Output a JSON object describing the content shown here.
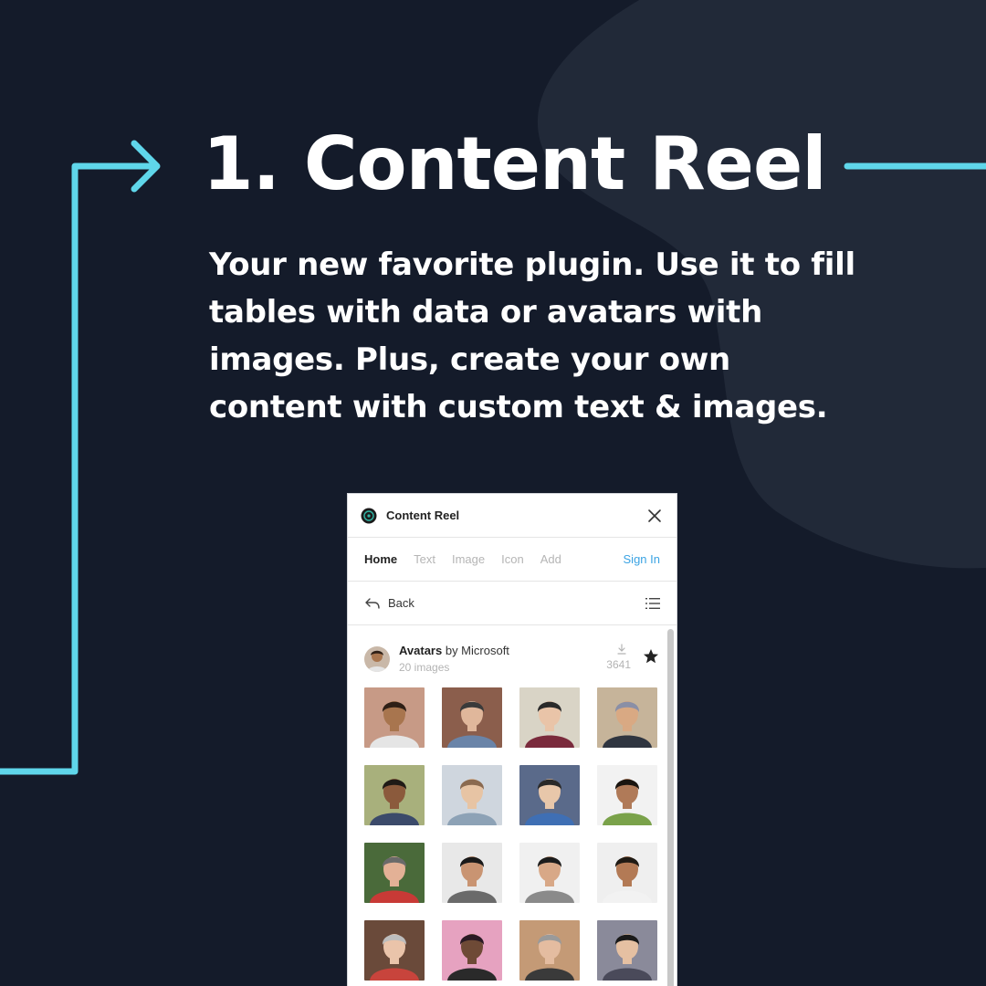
{
  "headline": "1. Content Reel",
  "description": "Your new favorite plugin. Use it to fill tables with data or avatars with images. Plus, create your own content with custom text & images.",
  "colors": {
    "background": "#141b2a",
    "blob": "#212938",
    "accent": "#5fd6ea"
  },
  "plugin": {
    "title": "Content Reel",
    "tabs": [
      "Home",
      "Text",
      "Image",
      "Icon",
      "Add"
    ],
    "active_tab": "Home",
    "sign_in": "Sign In",
    "back": "Back",
    "collection": {
      "name": "Avatars",
      "by": "by Microsoft",
      "count": "20 images",
      "downloads": "3641"
    },
    "avatars": [
      {
        "bg": "#c79a86",
        "skin": "#a8754e",
        "hair": "#2e1f16",
        "shirt": "#e5e5e5"
      },
      {
        "bg": "#8b5e4c",
        "skin": "#e0b79b",
        "hair": "#3a3a3a",
        "shirt": "#6a84a8"
      },
      {
        "bg": "#d9d4c6",
        "skin": "#e9c4a8",
        "hair": "#2a2a2a",
        "shirt": "#7a2a3c"
      },
      {
        "bg": "#c6b49a",
        "skin": "#d9a983",
        "hair": "#8a8fa6",
        "shirt": "#2f3540"
      },
      {
        "bg": "#a8b07c",
        "skin": "#8b5a3c",
        "hair": "#1f1a16",
        "shirt": "#3b4a6a"
      },
      {
        "bg": "#cfd6de",
        "skin": "#e7c4a4",
        "hair": "#8a6a50",
        "shirt": "#8da2b6"
      },
      {
        "bg": "#5a6a8a",
        "skin": "#e8c7aa",
        "hair": "#2a2a2a",
        "shirt": "#3f6fb4"
      },
      {
        "bg": "#f2f2f2",
        "skin": "#b07a58",
        "hair": "#1a1510",
        "shirt": "#7aa24a"
      },
      {
        "bg": "#4a6a3a",
        "skin": "#e3b196",
        "hair": "#6a6a6a",
        "shirt": "#c83a36"
      },
      {
        "bg": "#e8e8e8",
        "skin": "#c99472",
        "hair": "#1a1a1a",
        "shirt": "#6a6a6a"
      },
      {
        "bg": "#f0f0f0",
        "skin": "#d8a887",
        "hair": "#1c1c1c",
        "shirt": "#8a8a8a"
      },
      {
        "bg": "#efefef",
        "skin": "#b37a55",
        "hair": "#1f1a14",
        "shirt": "#f2f2f2"
      },
      {
        "bg": "#6a4a3a",
        "skin": "#eac4aa",
        "hair": "#bdbdbd",
        "shirt": "#c8443c"
      },
      {
        "bg": "#e6a2c0",
        "skin": "#6e4a36",
        "hair": "#2a1a24",
        "shirt": "#2a2a2a"
      },
      {
        "bg": "#c49a76",
        "skin": "#e4bca0",
        "hair": "#9a9a9a",
        "shirt": "#3a3a3a"
      },
      {
        "bg": "#8a8a9a",
        "skin": "#e5c0a2",
        "hair": "#1a1a1a",
        "shirt": "#4a4a5a"
      }
    ]
  }
}
